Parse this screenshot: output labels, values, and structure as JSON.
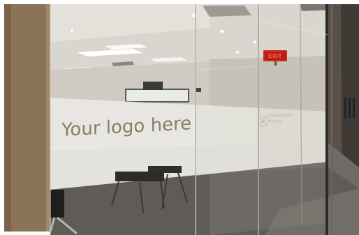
{
  "photo": {
    "glass_logo_text": "Your logo here",
    "exit_sign_text": "EXIT",
    "faded_brand_mark": "CREATIVE",
    "faded_brand_mark_line2": "TECH"
  },
  "colors": {
    "wall": "#8b7356",
    "ceiling": "#d9d6cf",
    "frosted_band": "#e8e7e3",
    "logo_text": "#8a7e63",
    "exit_sign": "#d02a1e",
    "carpet": "#6e6a66"
  }
}
